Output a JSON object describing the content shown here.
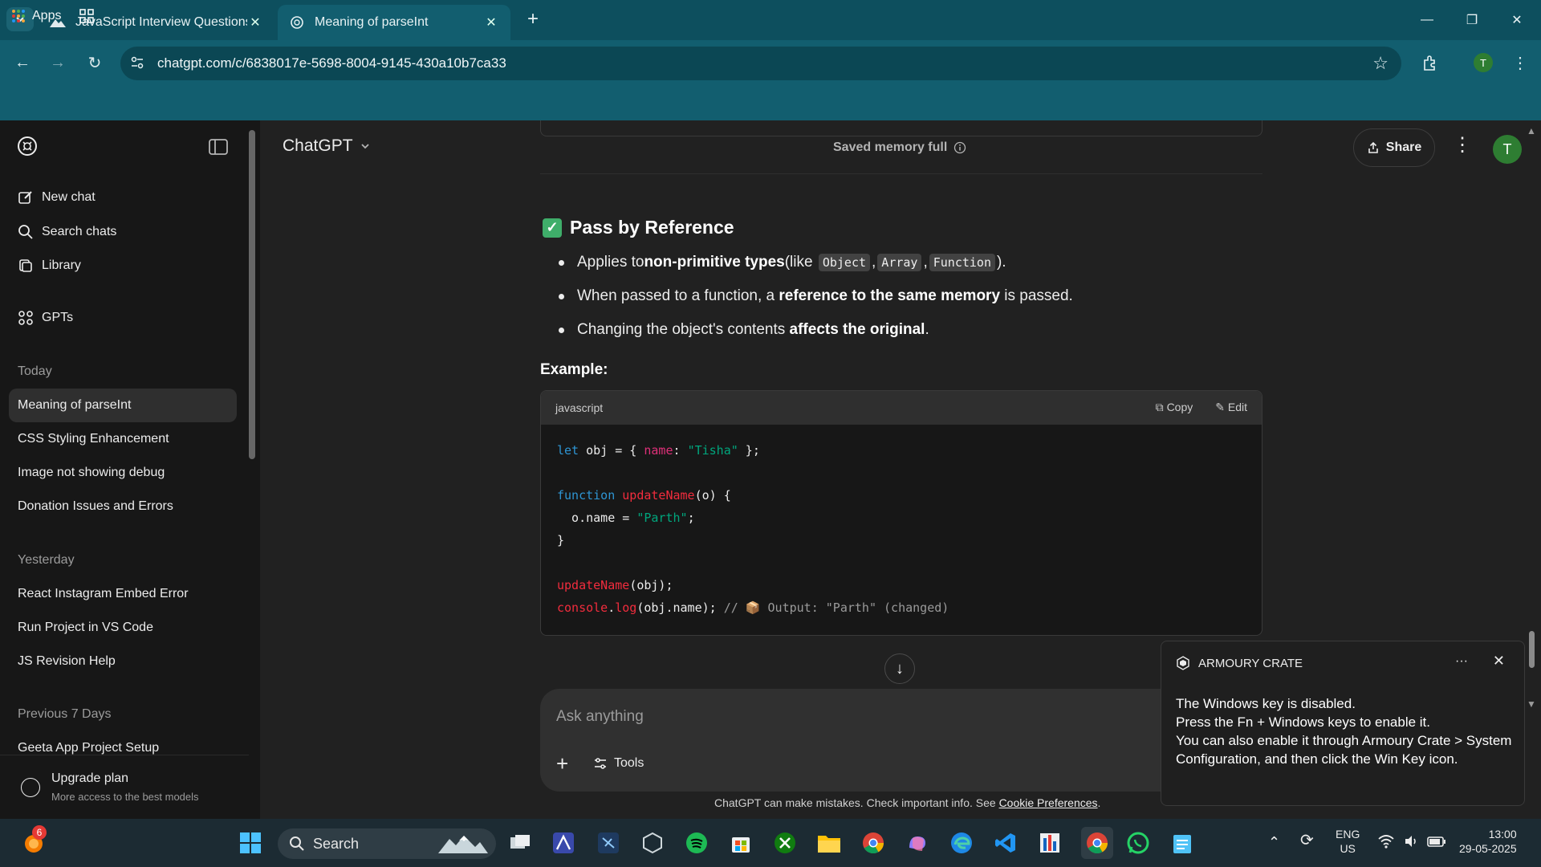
{
  "browser": {
    "tabs": [
      {
        "title": "JavaScript Interview Questions a",
        "active": false
      },
      {
        "title": "Meaning of parseInt",
        "active": true
      }
    ],
    "url": "chatgpt.com/c/6838017e-5698-8004-9145-430a10b7ca33",
    "bookmarks": {
      "apps_label": "Apps"
    },
    "profile_initial": "T"
  },
  "sidebar": {
    "new_chat": "New chat",
    "search_chats": "Search chats",
    "library": "Library",
    "gpts": "GPTs",
    "sections": [
      {
        "label": "Today",
        "chats": [
          "Meaning of parseInt",
          "CSS Styling Enhancement",
          "Image not showing debug",
          "Donation Issues and Errors"
        ]
      },
      {
        "label": "Yesterday",
        "chats": [
          "React Instagram Embed Error",
          "Run Project in VS Code",
          "JS Revision Help"
        ]
      },
      {
        "label": "Previous 7 Days",
        "chats": [
          "Geeta App Project Setup"
        ]
      }
    ],
    "upgrade_title": "Upgrade plan",
    "upgrade_sub": "More access to the best models"
  },
  "header": {
    "model": "ChatGPT",
    "memory": "Saved memory full",
    "share": "Share",
    "avatar": "T"
  },
  "content": {
    "heading": "Pass by Reference",
    "bullets": [
      {
        "pre": "Applies to ",
        "bold": "non-primitive types",
        "mid": " (like ",
        "codes": [
          "Object",
          "Array",
          "Function"
        ],
        "post": ")."
      },
      {
        "pre": "When passed to a function, a ",
        "bold": "reference to the same memory",
        "post": " is passed."
      },
      {
        "pre": "Changing the object's contents ",
        "bold": "affects the original",
        "post": "."
      }
    ],
    "example_label": "Example:",
    "code": {
      "lang": "javascript",
      "copy": "Copy",
      "edit": "Edit",
      "lines": [
        "let obj = { name: \"Tisha\" };",
        "",
        "function updateName(o) {",
        "  o.name = \"Parth\";",
        "}",
        "",
        "updateName(obj);",
        "console.log(obj.name); // 📦 Output: \"Parth\" (changed)"
      ]
    }
  },
  "composer": {
    "placeholder": "Ask anything",
    "tools": "Tools",
    "disclaimer": "ChatGPT can make mistakes. Check important info. See ",
    "disclaimer_link": "Cookie Preferences",
    "disclaimer_end": "."
  },
  "toast": {
    "app": "ARMOURY CRATE",
    "more": "···",
    "lines": [
      "The Windows key is disabled.",
      "Press the Fn + Windows keys to enable it.",
      "You can also enable it through Armoury Crate > System Configuration, and then click the Win Key icon."
    ]
  },
  "taskbar": {
    "search": "Search",
    "badge": "6",
    "lang1": "ENG",
    "lang2": "US",
    "time": "13:00",
    "date": "29-05-2025"
  }
}
